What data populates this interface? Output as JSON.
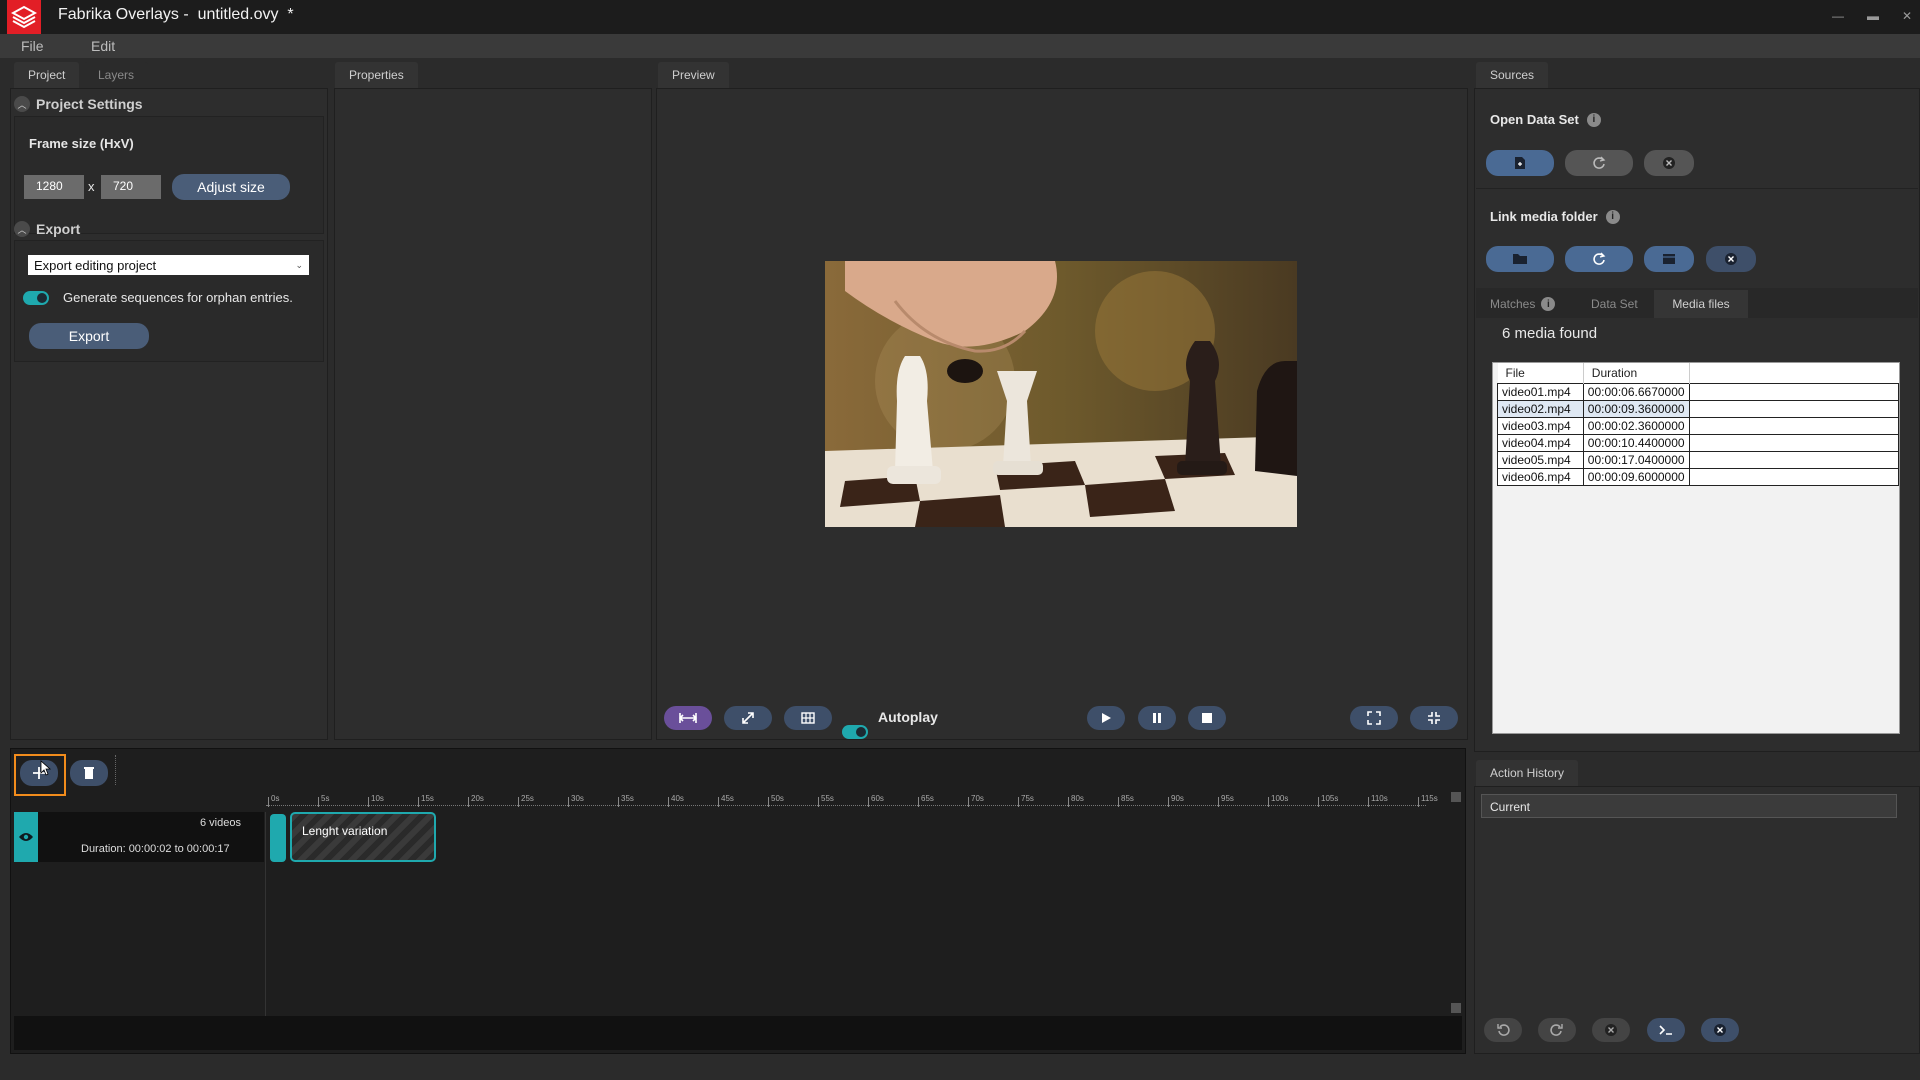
{
  "app": {
    "title": "Fabrika Overlays -  untitled.ovy  *"
  },
  "menu": [
    "File",
    "Edit"
  ],
  "left_panel": {
    "tabs": [
      "Project",
      "Layers"
    ],
    "project_settings": {
      "header": "Project Settings",
      "frame_size_label": "Frame size (HxV)",
      "width": "1280",
      "separator": "x",
      "height": "720",
      "adjust_button": "Adjust size"
    },
    "export": {
      "header": "Export",
      "select_value": "Export editing project",
      "toggle_label": "Generate sequences for orphan entries.",
      "toggle_on": true,
      "export_button": "Export"
    }
  },
  "properties_panel": {
    "tab": "Properties"
  },
  "preview_panel": {
    "tab": "Preview",
    "autoplay_label": "Autoplay",
    "autoplay_on": true
  },
  "sources_panel": {
    "tab": "Sources",
    "open_data_set_label": "Open Data Set",
    "link_media_folder_label": "Link media folder",
    "subtabs": [
      "Matches",
      "Data Set",
      "Media files"
    ],
    "active_subtab": "Media files",
    "media_found": "6 media found",
    "table": {
      "headers": [
        "File",
        "Duration"
      ],
      "rows": [
        [
          "video01.mp4",
          "00:00:06.6670000"
        ],
        [
          "video02.mp4",
          "00:00:09.3600000"
        ],
        [
          "video03.mp4",
          "00:00:02.3600000"
        ],
        [
          "video04.mp4",
          "00:00:10.4400000"
        ],
        [
          "video05.mp4",
          "00:00:17.0400000"
        ],
        [
          "video06.mp4",
          "00:00:09.6000000"
        ]
      ]
    }
  },
  "action_history": {
    "tab": "Action History",
    "items": [
      "Current"
    ]
  },
  "timeline": {
    "track": {
      "count_label": "6 videos",
      "duration_label": "Duration: 00:00:02 to 00:00:17"
    },
    "clip_label": "Lenght variation",
    "ruler_labels": [
      "0s",
      "5s",
      "10s",
      "15s",
      "20s",
      "25s",
      "30s",
      "35s",
      "40s",
      "45s",
      "50s",
      "55s",
      "60s",
      "65s",
      "70s",
      "75s",
      "80s",
      "85s",
      "90s",
      "95s",
      "100s",
      "105s",
      "110s",
      "115s"
    ]
  },
  "colors": {
    "accent_teal": "#1fa9ae",
    "brand_red": "#e21e26",
    "button_blue": "#4a5d78",
    "highlight_orange": "#f28c1c"
  }
}
